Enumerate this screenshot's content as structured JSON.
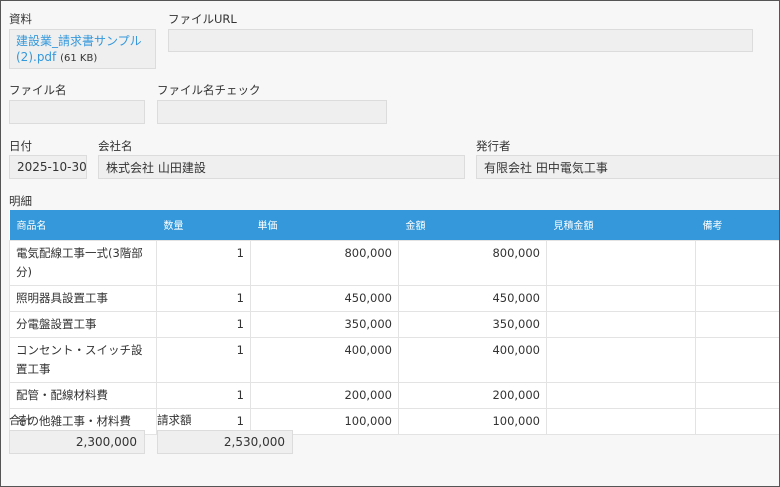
{
  "fields": {
    "attachment_label": "資料",
    "file_name_link": "建設業_請求書サンプル(2).pdf",
    "file_size": "(61 KB)",
    "file_url_label": "ファイルURL",
    "file_url_value": "",
    "file_name_label": "ファイル名",
    "file_name_value": "",
    "file_name_check_label": "ファイル名チェック",
    "file_name_check_value": "",
    "date_label": "日付",
    "date_value": "2025-10-30",
    "company_label": "会社名",
    "company_value": "株式会社 山田建設",
    "issuer_label": "発行者",
    "issuer_value": "有限会社 田中電気工事",
    "details_label": "明細",
    "total_label": "合計",
    "total_value": "2,300,000",
    "billed_label": "請求額",
    "billed_value": "2,530,000"
  },
  "table": {
    "headers": [
      "商品名",
      "数量",
      "単価",
      "金額",
      "見積金額",
      "備考"
    ],
    "rows": [
      [
        "電気配線工事一式(3階部分)",
        "1",
        "800,000",
        "800,000",
        "",
        ""
      ],
      [
        "照明器具設置工事",
        "1",
        "450,000",
        "450,000",
        "",
        ""
      ],
      [
        "分電盤設置工事",
        "1",
        "350,000",
        "350,000",
        "",
        ""
      ],
      [
        "コンセント・スイッチ設置工事",
        "1",
        "400,000",
        "400,000",
        "",
        ""
      ],
      [
        "配管・配線材料費",
        "1",
        "200,000",
        "200,000",
        "",
        ""
      ],
      [
        "その他雑工事・材料費",
        "1",
        "100,000",
        "100,000",
        "",
        ""
      ]
    ]
  }
}
